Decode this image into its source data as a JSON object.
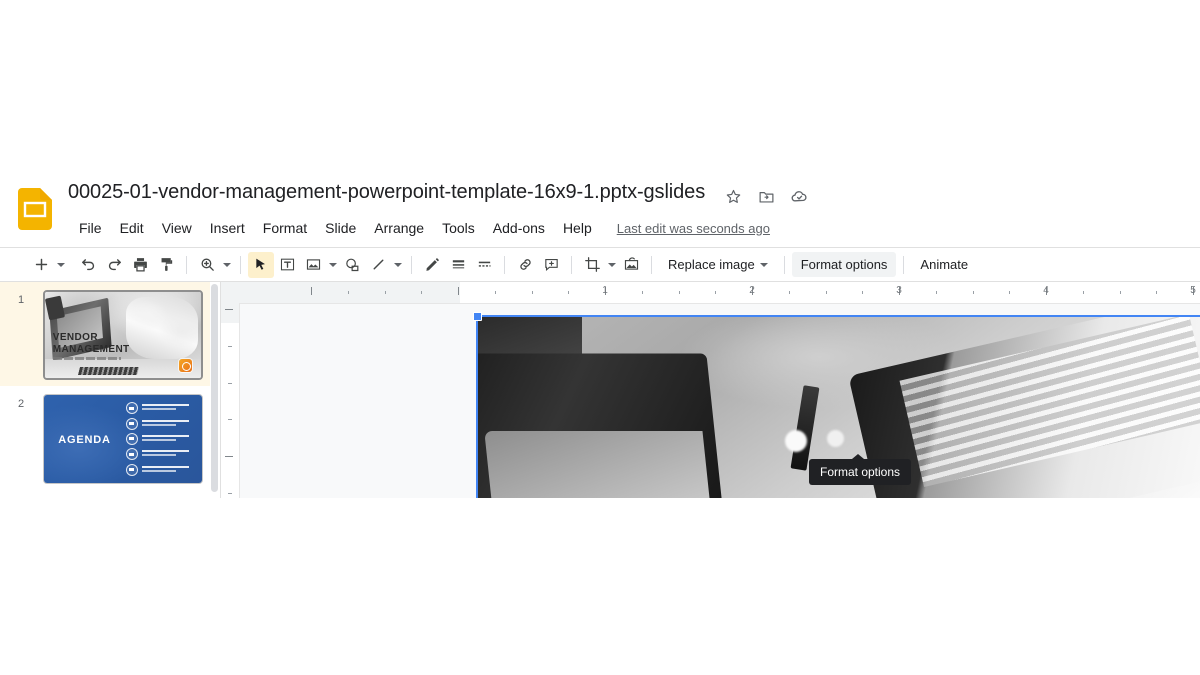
{
  "app": {
    "name": "Google Slides",
    "logo_icon": "slides-logo-icon"
  },
  "titlebar": {
    "document_title": "00025-01-vendor-management-powerpoint-template-16x9-1.pptx-gslides",
    "icons": [
      {
        "name": "star-icon",
        "label": "Star"
      },
      {
        "name": "move-to-folder-icon",
        "label": "Move to folder"
      },
      {
        "name": "cloud-status-icon",
        "label": "See document status"
      }
    ]
  },
  "menubar": {
    "items": [
      {
        "label": "File"
      },
      {
        "label": "Edit"
      },
      {
        "label": "View"
      },
      {
        "label": "Insert"
      },
      {
        "label": "Format"
      },
      {
        "label": "Slide"
      },
      {
        "label": "Arrange"
      },
      {
        "label": "Tools"
      },
      {
        "label": "Add-ons"
      },
      {
        "label": "Help"
      }
    ],
    "last_edit": "Last edit was seconds ago"
  },
  "toolbar": {
    "buttons": [
      {
        "name": "new-slide-button",
        "icon": "plus-icon",
        "label": "New slide"
      },
      {
        "name": "new-slide-dropdown",
        "icon": "chevron-down-icon",
        "label": "New slide options"
      },
      {
        "name": "undo-button",
        "icon": "undo-icon",
        "label": "Undo"
      },
      {
        "name": "redo-button",
        "icon": "redo-icon",
        "label": "Redo"
      },
      {
        "name": "print-button",
        "icon": "print-icon",
        "label": "Print"
      },
      {
        "name": "paint-format-button",
        "icon": "paint-format-icon",
        "label": "Paint format"
      },
      {
        "name": "zoom-button",
        "icon": "zoom-icon",
        "label": "Zoom"
      },
      {
        "name": "zoom-dropdown",
        "icon": "chevron-down-icon",
        "label": "Zoom options"
      },
      {
        "name": "select-tool-button",
        "icon": "cursor-arrow-icon",
        "label": "Select",
        "active": true
      },
      {
        "name": "text-box-button",
        "icon": "text-box-icon",
        "label": "Text box"
      },
      {
        "name": "insert-image-button",
        "icon": "image-icon",
        "label": "Insert image"
      },
      {
        "name": "insert-image-dropdown",
        "icon": "chevron-down-icon",
        "label": "Insert image options"
      },
      {
        "name": "shape-button",
        "icon": "shape-icon",
        "label": "Shape"
      },
      {
        "name": "line-button",
        "icon": "line-icon",
        "label": "Line"
      },
      {
        "name": "line-dropdown",
        "icon": "chevron-down-icon",
        "label": "Line options"
      },
      {
        "name": "pen-button",
        "icon": "pencil-icon",
        "label": "Pen"
      },
      {
        "name": "line-weight-button",
        "icon": "line-weight-icon",
        "label": "Line weight"
      },
      {
        "name": "line-dash-button",
        "icon": "line-dash-icon",
        "label": "Line dash"
      },
      {
        "name": "insert-link-button",
        "icon": "link-icon",
        "label": "Insert link"
      },
      {
        "name": "add-comment-button",
        "icon": "add-comment-icon",
        "label": "Add comment"
      },
      {
        "name": "crop-button",
        "icon": "crop-icon",
        "label": "Crop image"
      },
      {
        "name": "crop-dropdown",
        "icon": "chevron-down-icon",
        "label": "Mask image"
      },
      {
        "name": "reset-image-button",
        "icon": "reset-image-icon",
        "label": "Reset image"
      }
    ],
    "replace_image_label": "Replace image",
    "format_options_label": "Format options",
    "animate_label": "Animate"
  },
  "tooltip": {
    "text": "Format options"
  },
  "ruler": {
    "horizontal_numbers": [
      "1",
      "2",
      "3",
      "4",
      "5"
    ],
    "unit": "inches"
  },
  "slide_panel": {
    "slides": [
      {
        "number": "1",
        "selected": true,
        "title": "VENDOR\nMANAGEMENT",
        "title_line1": "VENDOR",
        "title_line2": "MANAGEMENT",
        "type": "title-photo"
      },
      {
        "number": "2",
        "selected": false,
        "title": "AGENDA",
        "type": "agenda-list",
        "items_count": 5,
        "item_text": "This is a sample text for presentation.",
        "background_color": "#2a5ba4"
      }
    ]
  },
  "canvas": {
    "selected_object": "image",
    "selection_color": "#4285f4",
    "image_description": "grayscale photo of laptop and desk"
  },
  "colors": {
    "brand_yellow": "#f4b400",
    "selection_blue": "#4285f4",
    "toolbar_active": "#fdf0cc",
    "text_primary": "#202124",
    "text_secondary": "#5f6368",
    "stage_bg": "#f8f9fa",
    "slide_selected_bg": "#fef7e6"
  }
}
